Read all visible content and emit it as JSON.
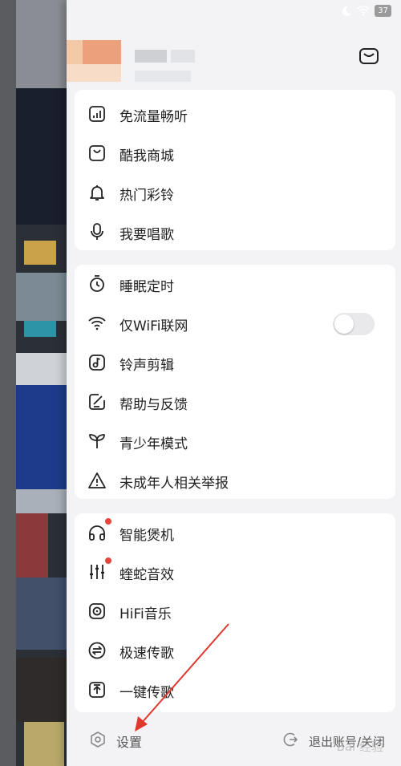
{
  "status_bar": {
    "moon_icon": "moon-icon",
    "wifi_icon": "wifi-signal-icon",
    "battery": "37"
  },
  "header": {
    "mail_icon": "mail-icon"
  },
  "card1": {
    "items": [
      {
        "icon": "data-free-icon",
        "label": "免流量畅听"
      },
      {
        "icon": "shopping-bag-icon",
        "label": "酷我商城"
      },
      {
        "icon": "bell-icon",
        "label": "热门彩铃"
      },
      {
        "icon": "microphone-icon",
        "label": "我要唱歌"
      }
    ]
  },
  "card2": {
    "items": [
      {
        "icon": "timer-icon",
        "label": "睡眠定时"
      },
      {
        "icon": "wifi-icon",
        "label": "仅WiFi联网",
        "toggle": false
      },
      {
        "icon": "music-note-icon",
        "label": "铃声剪辑"
      },
      {
        "icon": "feedback-icon",
        "label": "帮助与反馈"
      },
      {
        "icon": "sprout-icon",
        "label": "青少年模式"
      },
      {
        "icon": "warning-icon",
        "label": "未成年人相关举报"
      }
    ]
  },
  "card3": {
    "items": [
      {
        "icon": "headphones-icon",
        "label": "智能煲机",
        "badge": true
      },
      {
        "icon": "equalizer-icon",
        "label": "蝰蛇音效",
        "badge": true
      },
      {
        "icon": "hifi-icon",
        "label": "HiFi音乐"
      },
      {
        "icon": "transfer-icon",
        "label": "极速传歌"
      },
      {
        "icon": "upload-icon",
        "label": "一键传歌"
      }
    ]
  },
  "bottom": {
    "settings_label": "设置",
    "logout_label": "退出账号/关闭"
  },
  "watermark": "Bai 经验",
  "colors": {
    "badge": "#e5453c",
    "arrow": "#e0382f",
    "panel_bg": "#f3f3f5",
    "card_bg": "#ffffff"
  }
}
